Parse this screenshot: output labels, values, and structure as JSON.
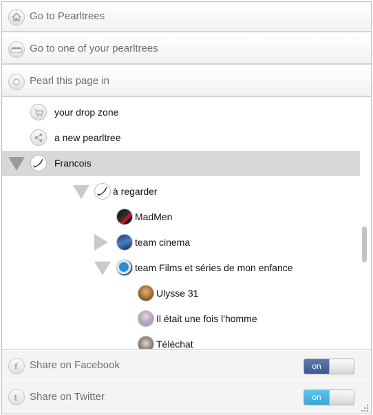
{
  "header": {
    "go_to_pearltrees": "Go to Pearltrees",
    "go_to_one": "Go to one of your pearltrees",
    "pearl_page_in": "Pearl this page in"
  },
  "tree": {
    "drop_zone": "your drop zone",
    "new_pearltree": "a new pearltree",
    "francois": "Francois",
    "a_regarder": "à regarder",
    "madmen": "MadMen",
    "team_cinema": "team cinema",
    "team_films": "team Films et séries de mon enfance",
    "ulysse": "Ulysse 31",
    "il_etait": "Il était une fois l'homme",
    "telechat": "Téléchat"
  },
  "share": {
    "facebook_label": "Share on Facebook",
    "facebook_toggle": "on",
    "twitter_label": "Share on Twitter",
    "twitter_toggle": "on"
  },
  "colors": {
    "facebook_on": "#3f5a8f",
    "twitter_on": "#37a8d6",
    "selected_row": "#d8d8d8"
  },
  "icons": [
    "home-icon",
    "pearltrees-icon",
    "pearl-icon",
    "cart-icon",
    "share-icon",
    "facebook-icon",
    "twitter-icon"
  ]
}
